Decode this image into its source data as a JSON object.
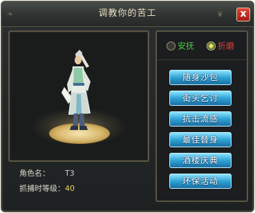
{
  "dialog": {
    "title": "调教你的苦工",
    "close_label": "x"
  },
  "character": {
    "name_label": "角色名：",
    "name_value": "T3",
    "level_label": "抓捕时等级：",
    "level_value": "40"
  },
  "tabs": [
    {
      "label": "安抚",
      "selected": false,
      "color": "#49c74a"
    },
    {
      "label": "折磨",
      "selected": true,
      "color": "#e0403a"
    }
  ],
  "actions": [
    {
      "label": "随身沙包"
    },
    {
      "label": "街头乞讨"
    },
    {
      "label": "抗击流感"
    },
    {
      "label": "最佳替身"
    },
    {
      "label": "酒楼庆典"
    },
    {
      "label": "环保活动"
    }
  ]
}
